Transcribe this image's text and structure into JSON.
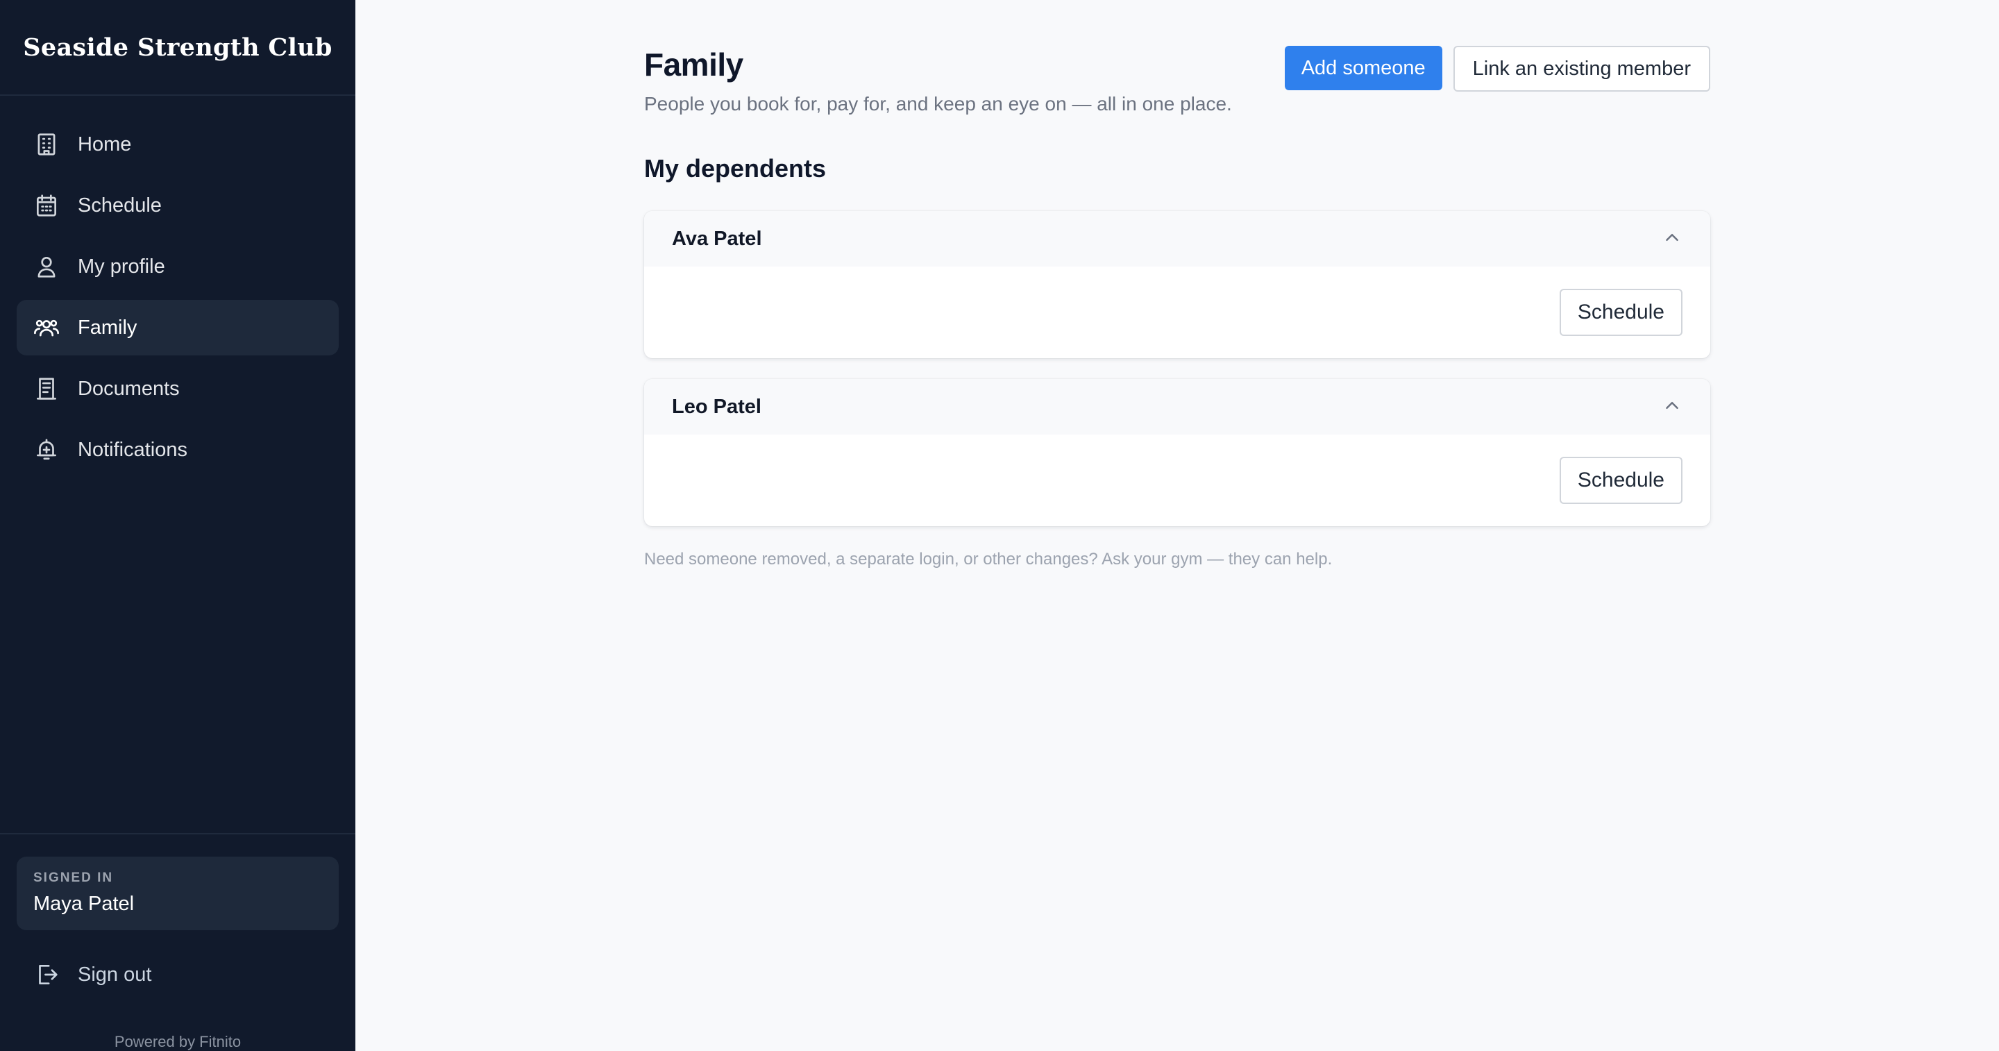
{
  "brand": {
    "name": "Seaside Strength Club"
  },
  "nav": {
    "items": [
      {
        "label": "Home",
        "icon": "building-icon",
        "active": false
      },
      {
        "label": "Schedule",
        "icon": "calendar-icon",
        "active": false
      },
      {
        "label": "My profile",
        "icon": "user-icon",
        "active": false
      },
      {
        "label": "Family",
        "icon": "users-icon",
        "active": true
      },
      {
        "label": "Documents",
        "icon": "document-icon",
        "active": false
      },
      {
        "label": "Notifications",
        "icon": "bell-icon",
        "active": false
      }
    ]
  },
  "account": {
    "signed_in_label": "SIGNED IN",
    "user_name": "Maya Patel",
    "sign_out_label": "Sign out"
  },
  "footer": {
    "powered_by": "Powered by Fitnito"
  },
  "page": {
    "title": "Family",
    "subtitle": "People you book for, pay for, and keep an eye on — all in one place.",
    "add_button": "Add someone",
    "link_button": "Link an existing member",
    "section_title": "My dependents",
    "footnote": "Need someone removed, a separate login, or other changes? Ask your gym — they can help."
  },
  "dependents": [
    {
      "name": "Ava Patel",
      "expanded": true,
      "action_label": "Schedule"
    },
    {
      "name": "Leo Patel",
      "expanded": true,
      "action_label": "Schedule"
    }
  ],
  "colors": {
    "sidebar_bg": "#111a2c",
    "active_item_bg": "#1e293b",
    "primary": "#2f80ed",
    "page_bg": "#f8f9fb"
  }
}
